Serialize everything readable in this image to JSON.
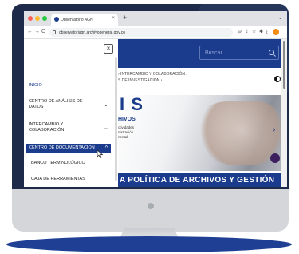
{
  "browser": {
    "tab_title": "Observatorio AGN",
    "tab_close": "×",
    "new_tab": "+",
    "tab_menu": "⌄",
    "url": "observatoriagn.archivogeneral.gov.co",
    "back": "←",
    "forward": "→",
    "reload": "C"
  },
  "header": {
    "search_placeholder": "Buscar..."
  },
  "breadcrumb": {
    "line1": "› INTERCAMBIO Y COLABORACIÓN ›",
    "line2": "S DE INVESTIGACIÓN ›"
  },
  "hero": {
    "title": "I S",
    "subtitle": "HIVOS",
    "text": "ctividades\nnistración\n nental.",
    "next": "›"
  },
  "banner": {
    "text": "A POLÍTICA DE ARCHIVOS Y GESTIÓN"
  },
  "menu": {
    "close": "×",
    "inicio": "INICIO",
    "items": [
      {
        "label": "CENTRO DE ANÁLISIS DE DATOS",
        "chevron": "⌄"
      },
      {
        "label": "INTERCAMBIO Y COLABORACIÓN",
        "chevron": "⌄"
      },
      {
        "label": "CENTRO DE DOCUMENTACIÓN",
        "chevron": "^"
      }
    ],
    "subitems": [
      "BANCO TERMINOLÓGICO",
      "CAJA DE HERRAMIENTAS"
    ]
  },
  "colors": {
    "brand_blue": "#1b3c8c",
    "bezel": "#1e2a4a",
    "base": "#1e3f94"
  }
}
